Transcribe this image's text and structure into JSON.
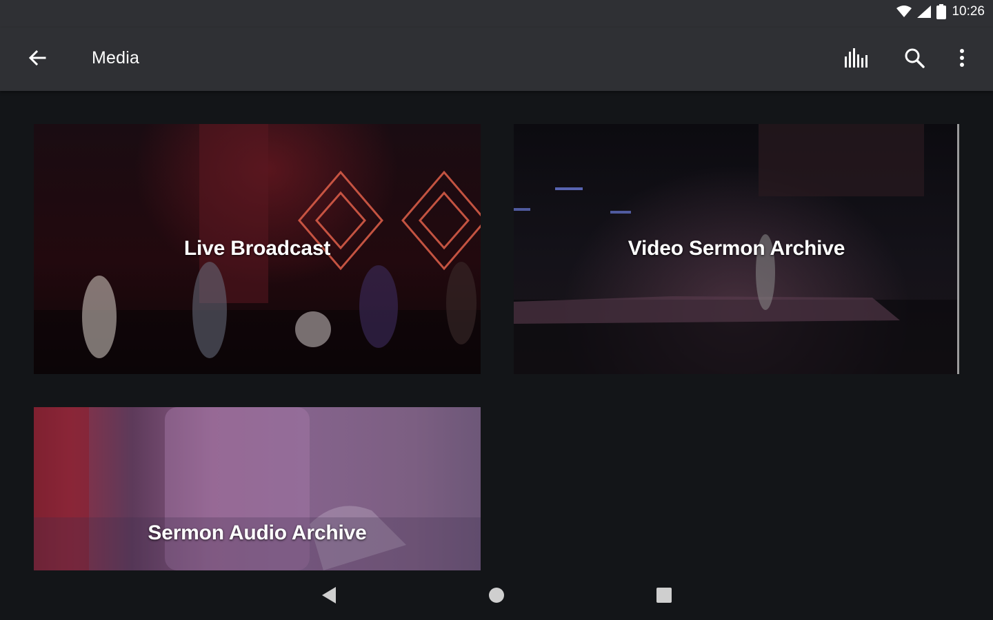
{
  "status_bar": {
    "time": "10:26",
    "icons": [
      "wifi-icon",
      "signal-icon",
      "battery-icon"
    ]
  },
  "app_bar": {
    "title": "Media",
    "back_icon": "arrow-back-icon",
    "actions": [
      "equalizer-icon",
      "search-icon",
      "more-vert-icon"
    ]
  },
  "tiles": [
    {
      "label": "Live Broadcast"
    },
    {
      "label": "Video Sermon Archive"
    },
    {
      "label": "Sermon Audio Archive"
    }
  ],
  "nav_bar": {
    "buttons": [
      "nav-back-icon",
      "nav-home-icon",
      "nav-recents-icon"
    ]
  },
  "colors": {
    "app_bar": "#2f3034",
    "background": "#131518",
    "text": "#ffffff"
  }
}
